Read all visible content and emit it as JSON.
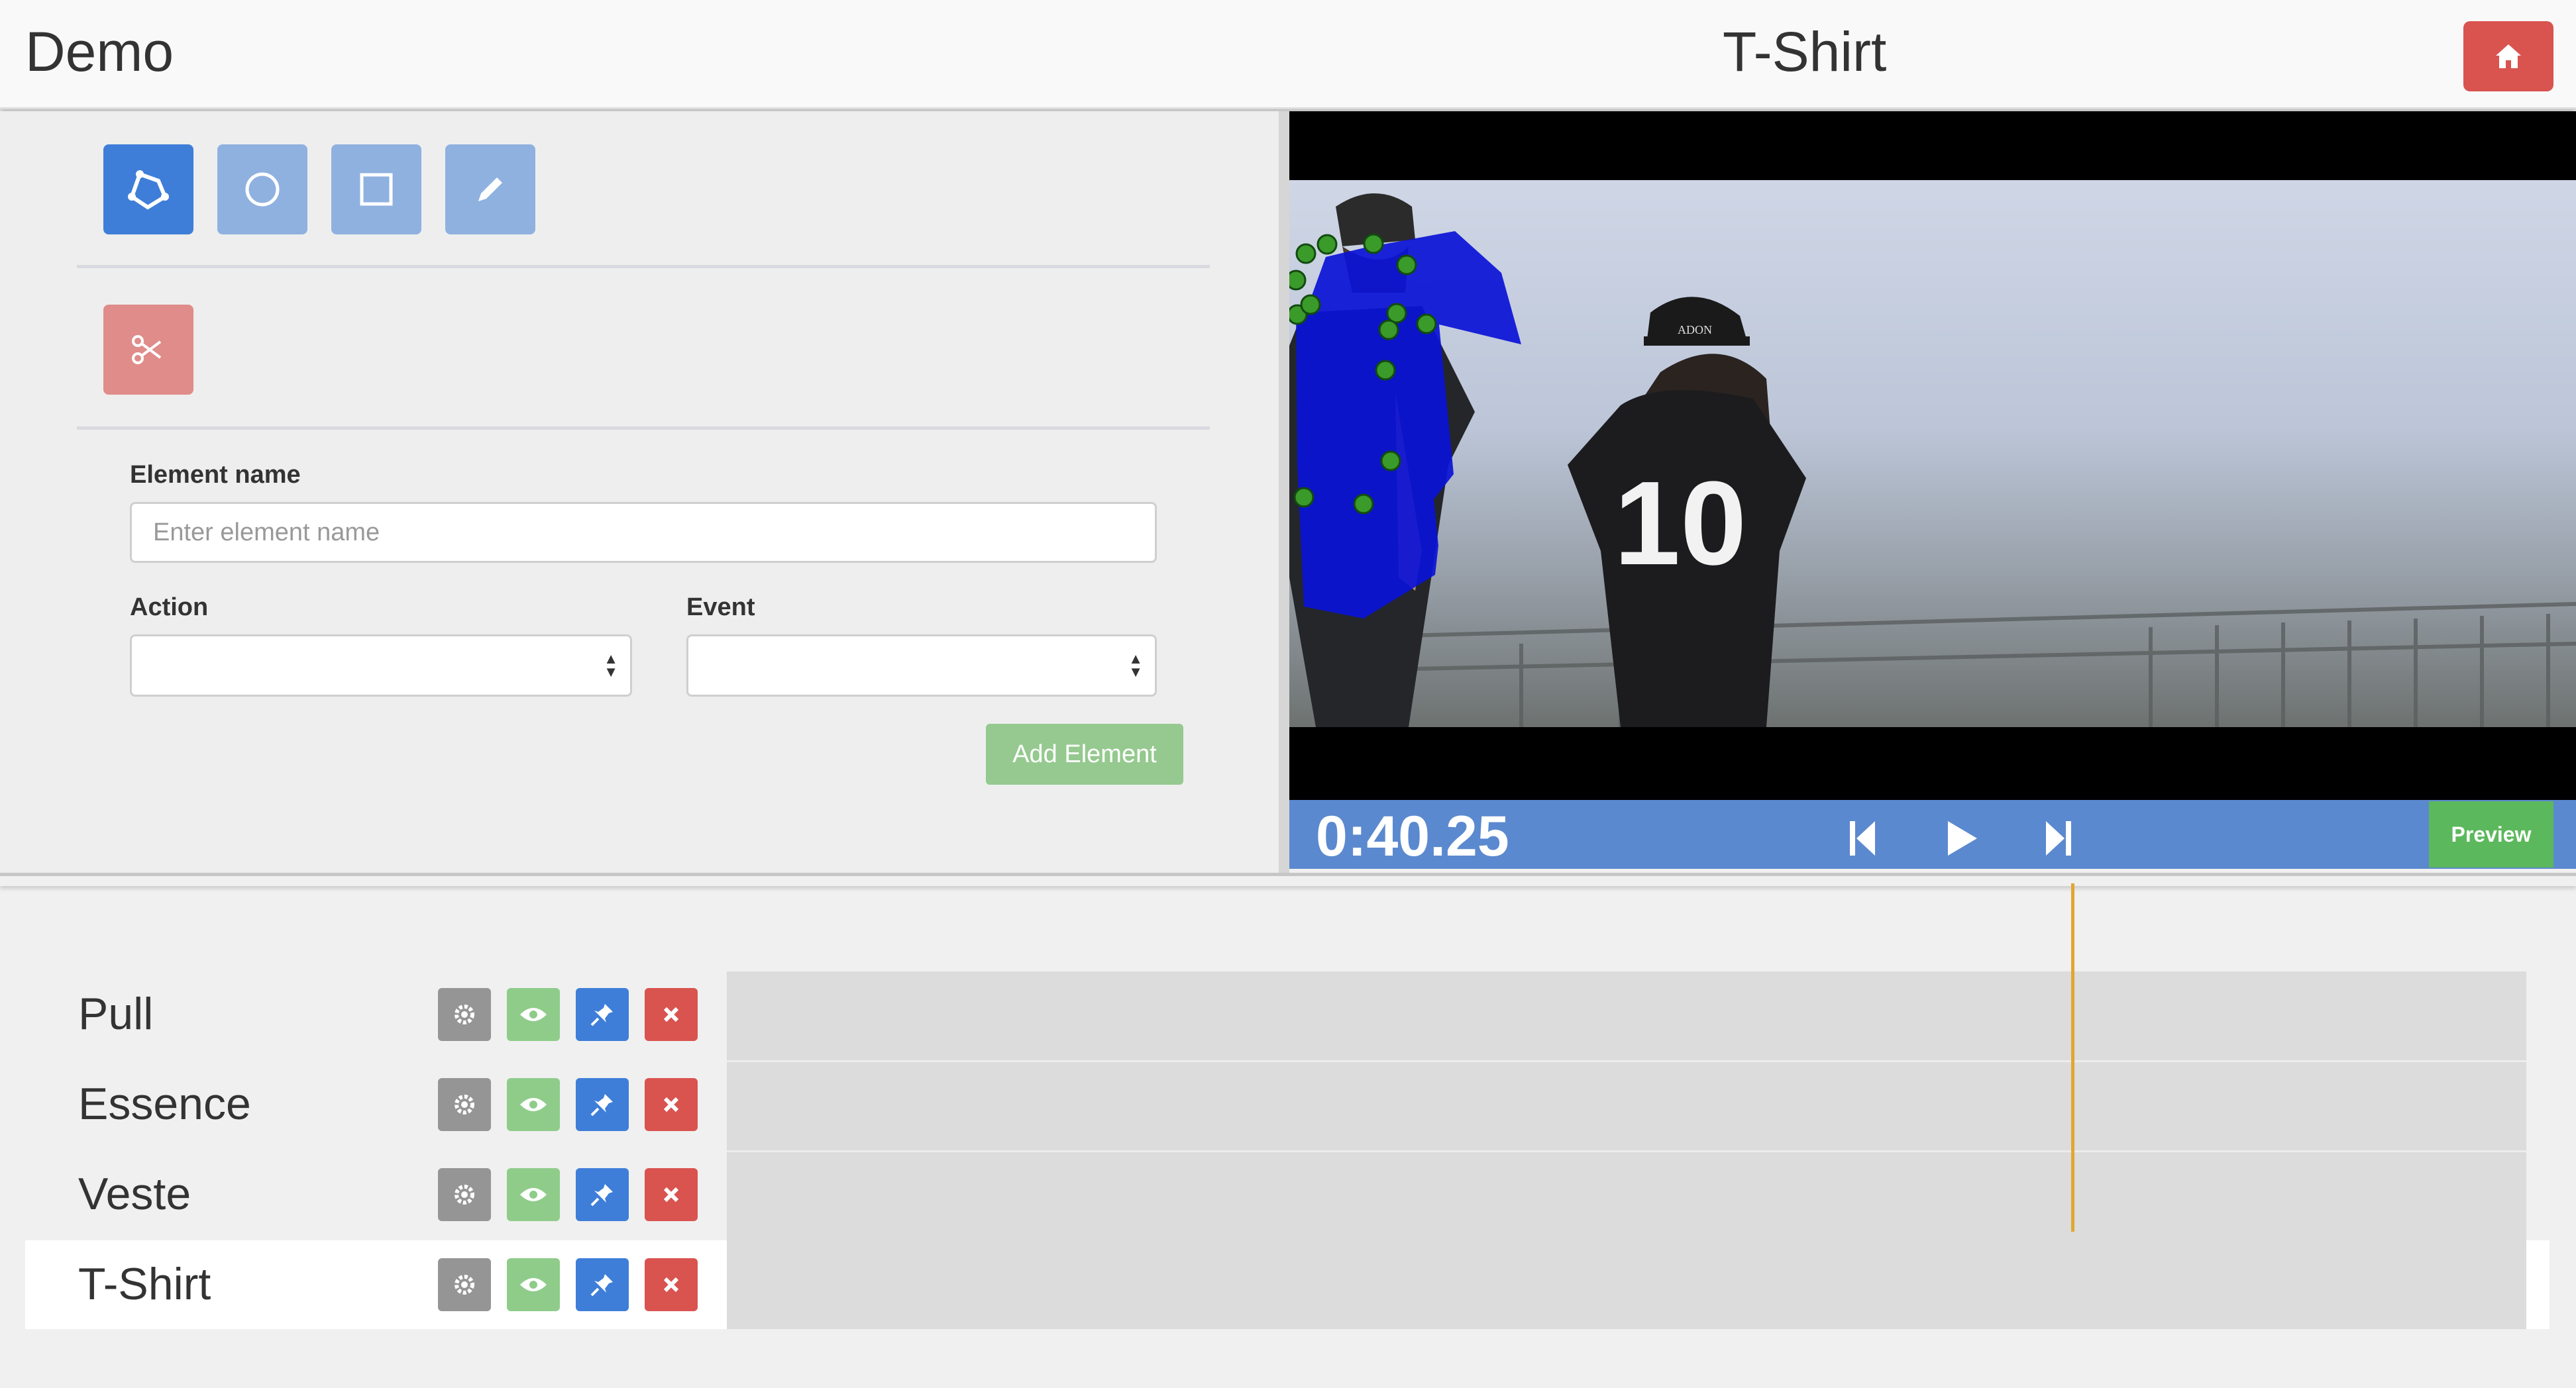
{
  "header": {
    "app_title": "Demo",
    "page_title": "T-Shirt",
    "home_icon": "home-icon"
  },
  "tools": {
    "drawing_tools": [
      {
        "name": "polygon-tool",
        "icon": "polygon-icon",
        "active": true
      },
      {
        "name": "circle-tool",
        "icon": "circle-icon",
        "active": false
      },
      {
        "name": "rectangle-tool",
        "icon": "square-icon",
        "active": false
      },
      {
        "name": "pencil-tool",
        "icon": "pencil-icon",
        "active": false
      }
    ],
    "cut_tool": {
      "icon": "scissors-icon"
    }
  },
  "form": {
    "element_name_label": "Element name",
    "element_name_placeholder": "Enter element name",
    "element_name_value": "",
    "action_label": "Action",
    "action_value": "",
    "event_label": "Event",
    "event_value": "",
    "add_button_label": "Add Element"
  },
  "video": {
    "jersey_number": "10",
    "cap_text": "ADON",
    "timecode": "0:40.25",
    "preview_label": "Preview",
    "controls": [
      "skip-back-icon",
      "play-icon",
      "skip-forward-icon"
    ]
  },
  "timeline": {
    "rows": [
      {
        "label": "Pull",
        "selected": false
      },
      {
        "label": "Essence",
        "selected": false
      },
      {
        "label": "Veste",
        "selected": false
      },
      {
        "label": "T-Shirt",
        "selected": true
      }
    ],
    "row_actions": [
      "gear-icon",
      "eye-icon",
      "pin-icon",
      "close-icon"
    ]
  },
  "colors": {
    "header_bg": "#f9f9f9",
    "tool_active": "#3e7ed8",
    "tool_inactive": "#8fb1e0",
    "cut_tool": "#e08c8a",
    "add_button": "#95c98f",
    "control_bar": "#5b89cf",
    "preview_button": "#5cb85c",
    "home_button": "#d9534f",
    "polygon_fill": "#0a12d6",
    "polygon_vertex": "#3a9a2a",
    "playhead": "#e0a830"
  }
}
